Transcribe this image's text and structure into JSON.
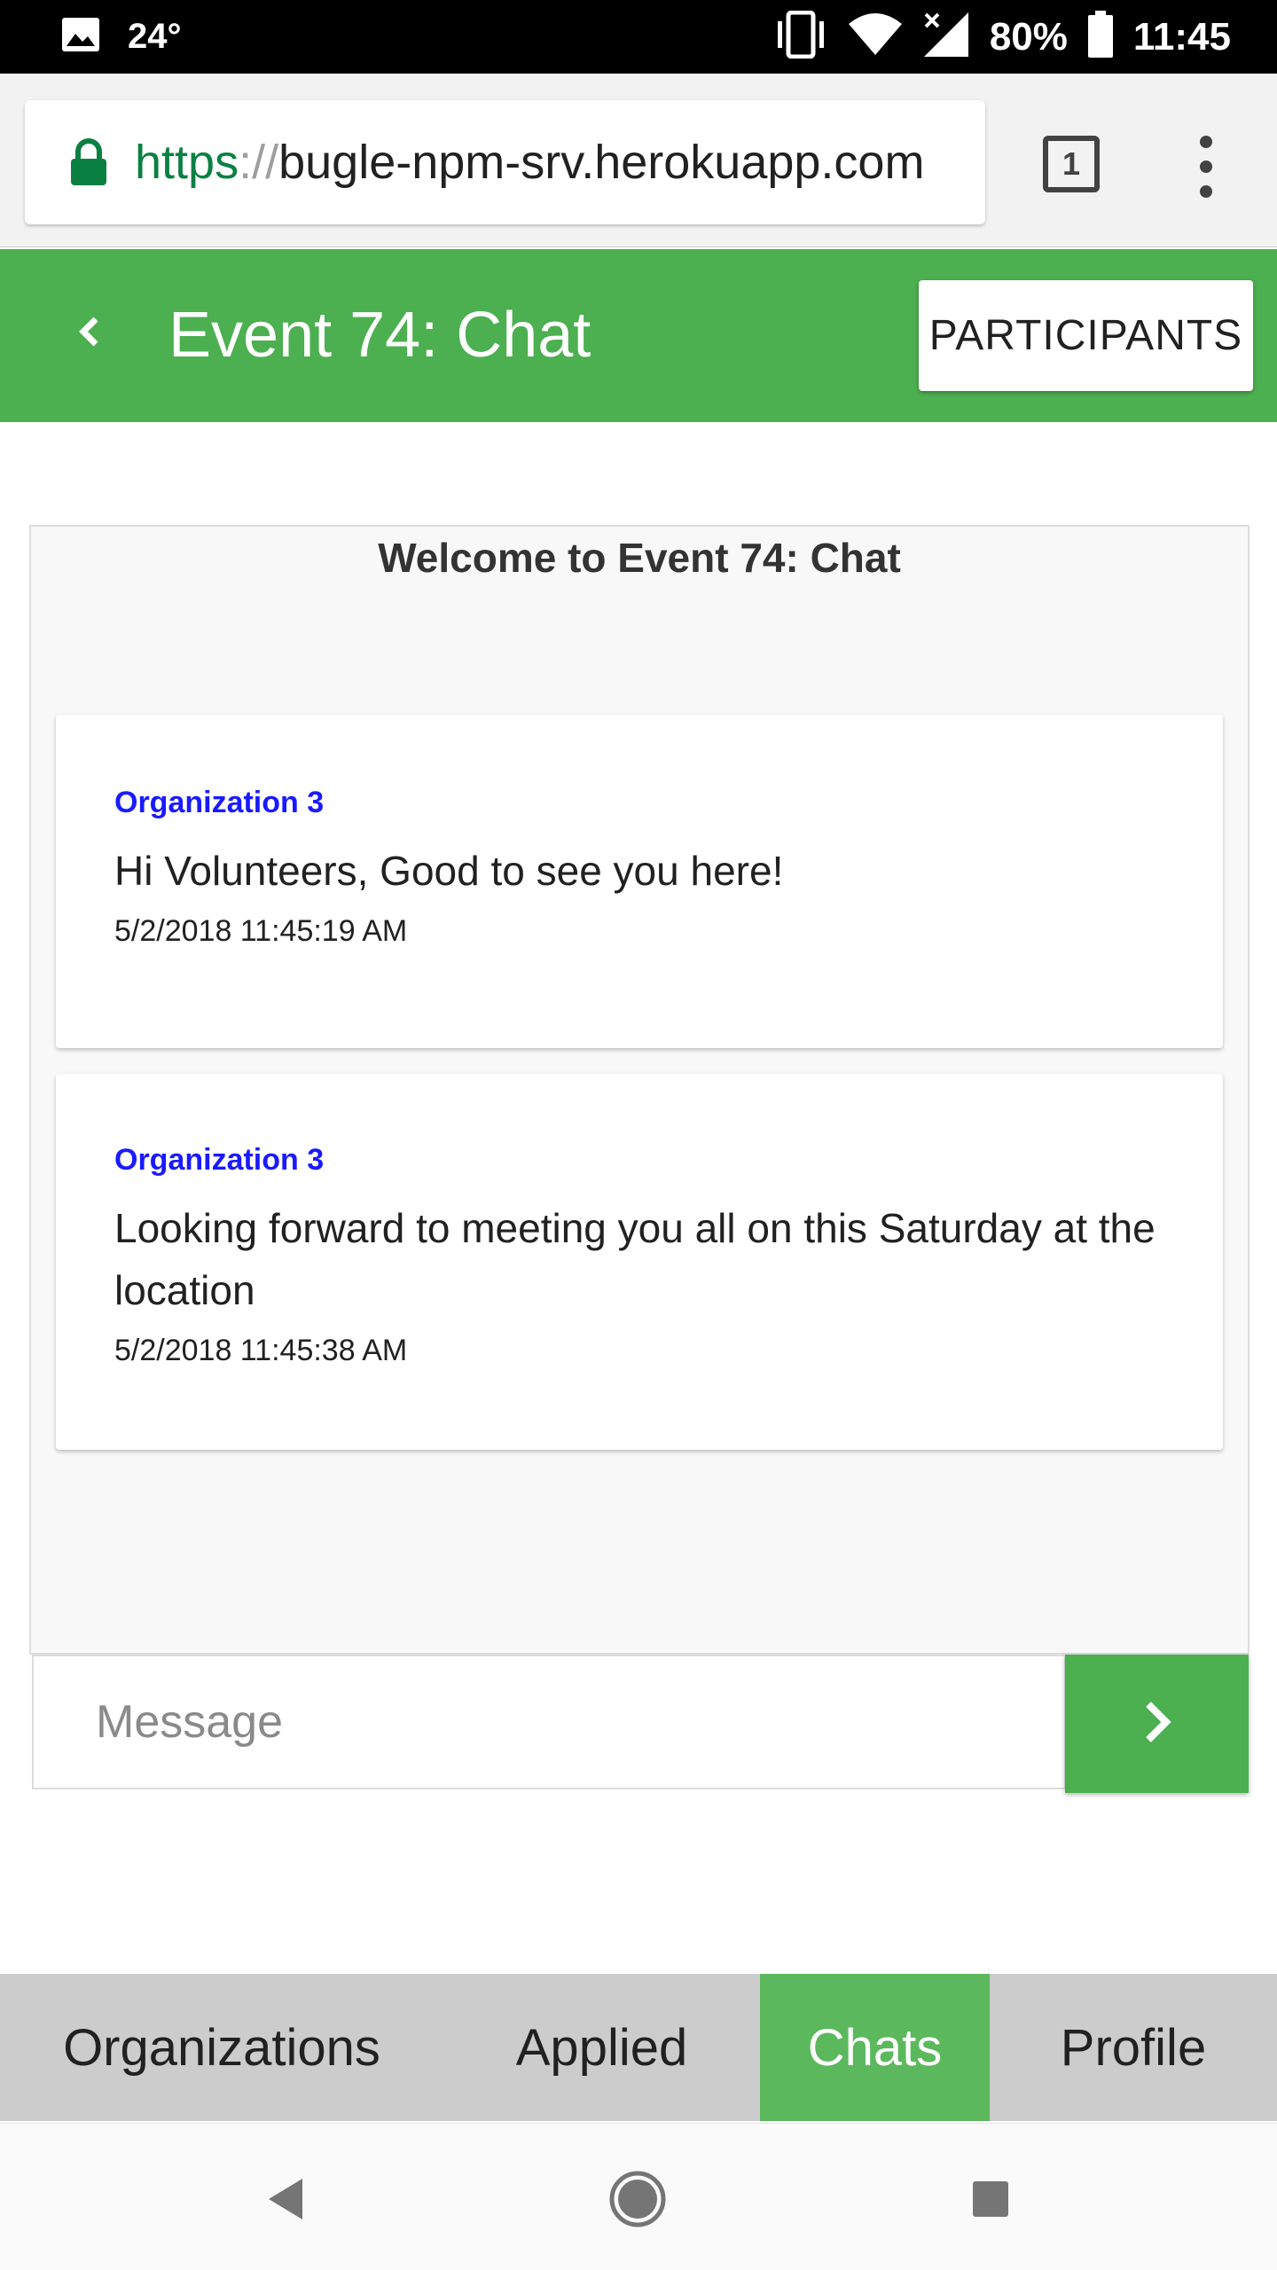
{
  "status_bar": {
    "temperature": "24°",
    "battery": "80%",
    "time": "11:45"
  },
  "browser": {
    "url_scheme": "https",
    "url_separator": "://",
    "url_host": "bugle-npm-srv.herokuapp.com",
    "tab_count": "1"
  },
  "header": {
    "title": "Event 74: Chat",
    "participants_label": "PARTICIPANTS"
  },
  "chat": {
    "welcome": "Welcome to Event 74: Chat",
    "messages": [
      {
        "sender": "Organization 3",
        "text": "Hi Volunteers, Good to see you here!",
        "timestamp": "5/2/2018 11:45:19 AM"
      },
      {
        "sender": "Organization 3",
        "text": "Looking forward to meeting you all on this Saturday at the location",
        "timestamp": "5/2/2018 11:45:38 AM"
      }
    ]
  },
  "composer": {
    "placeholder": "Message"
  },
  "tabs": [
    {
      "label": "Organizations",
      "active": false
    },
    {
      "label": "Applied",
      "active": false
    },
    {
      "label": "Chats",
      "active": true
    },
    {
      "label": "Profile",
      "active": false
    }
  ],
  "colors": {
    "primary": "#4caf50",
    "active_tab": "#5cb85c",
    "sender": "#1a1aff",
    "url_scheme": "#0b8043"
  },
  "icons": [
    "image-icon",
    "vibrate-icon",
    "wifi-icon",
    "signal-icon",
    "battery-icon",
    "lock-icon",
    "tab-switcher-icon",
    "more-vert-icon",
    "chevron-left-icon",
    "chevron-right-icon",
    "nav-back-icon",
    "nav-home-icon",
    "nav-recents-icon"
  ]
}
